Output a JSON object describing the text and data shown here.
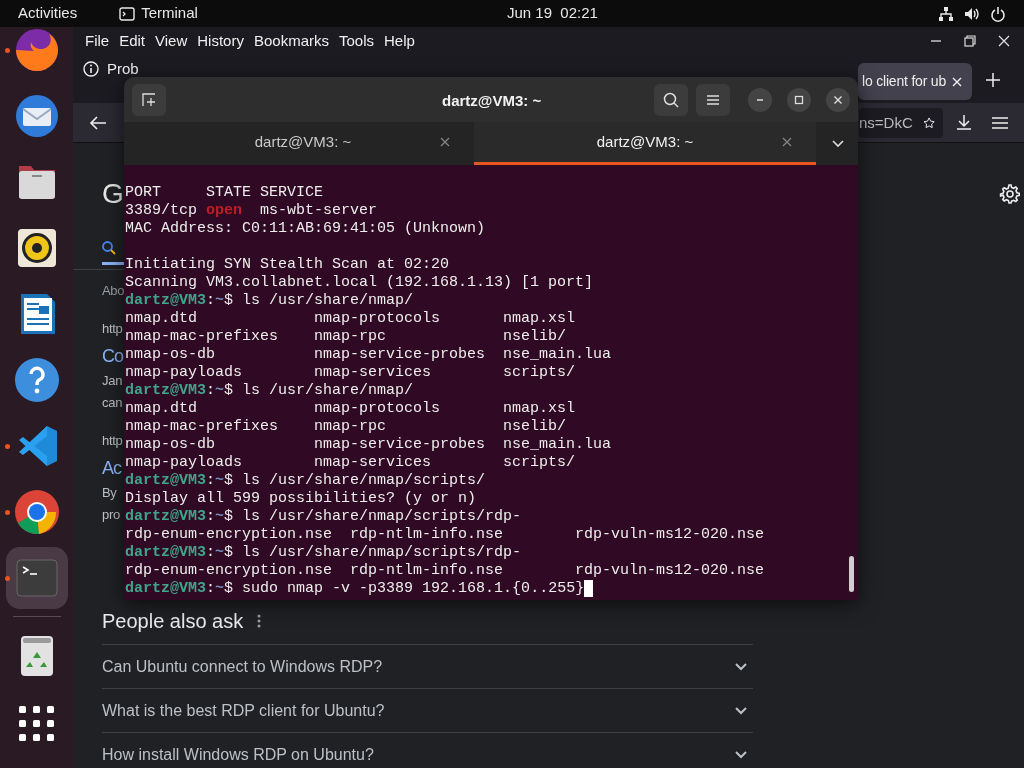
{
  "top_bar": {
    "activities": "Activities",
    "app_name": "Terminal",
    "clock": "Jun 19  02:21"
  },
  "dock": {
    "items": [
      {
        "kind": "globe",
        "running": true,
        "selected": false
      },
      {
        "kind": "mail",
        "running": false,
        "selected": false
      },
      {
        "kind": "folder",
        "running": false,
        "selected": false
      },
      {
        "kind": "speaker",
        "running": false,
        "selected": false
      },
      {
        "kind": "document",
        "running": false,
        "selected": false
      },
      {
        "kind": "help",
        "running": false,
        "selected": false
      },
      {
        "kind": "code",
        "running": true,
        "selected": false
      },
      {
        "kind": "browser",
        "running": true,
        "selected": false
      },
      {
        "kind": "terminal",
        "running": true,
        "selected": true
      }
    ],
    "bottom_items": [
      {
        "kind": "trash"
      },
      {
        "kind": "apps"
      }
    ]
  },
  "browser": {
    "menu": [
      "File",
      "Edit",
      "View",
      "History",
      "Bookmarks",
      "Tools",
      "Help"
    ],
    "tab_fragment": "Prob",
    "tab": {
      "title": "lo client for ub"
    },
    "url_fragment": "ns=DkC",
    "page": {
      "logo_fragment": "G",
      "fragments": [
        {
          "kind": "label",
          "text": "Abo"
        },
        {
          "kind": "url",
          "text": "http"
        },
        {
          "kind": "heading",
          "text": "Co"
        },
        {
          "kind": "snippet",
          "text": "Jan"
        },
        {
          "kind": "snippet",
          "text": "can"
        },
        {
          "kind": "url",
          "text": "http"
        },
        {
          "kind": "heading",
          "text": "Ac"
        },
        {
          "kind": "snippet",
          "text": "By"
        },
        {
          "kind": "snippet",
          "text": "pro"
        }
      ],
      "people_also_ask": {
        "title": "People also ask",
        "questions": [
          "Can Ubuntu connect to Windows RDP?",
          "What is the best RDP client for Ubuntu?",
          "How install Windows RDP on Ubuntu?"
        ]
      }
    }
  },
  "terminal": {
    "title": "dartz@VM3: ~",
    "tabs": [
      {
        "title": "dartz@VM3: ~",
        "selected": false
      },
      {
        "title": "dartz@VM3: ~",
        "selected": true
      }
    ],
    "lines": [
      {
        "kind": "output",
        "text": "PORT     STATE SERVICE"
      },
      {
        "kind": "port",
        "port": "3389/tcp",
        "state": "open",
        "service": "ms-wbt-server"
      },
      {
        "kind": "output",
        "text": "MAC Address: C0:11:AB:69:41:05 (Unknown)"
      },
      {
        "kind": "blank"
      },
      {
        "kind": "output",
        "text": "Initiating SYN Stealth Scan at 02:20"
      },
      {
        "kind": "output",
        "text": "Scanning VM3.collabnet.local (192.168.1.13) [1 port]"
      },
      {
        "kind": "prompt",
        "user": "dartz@VM3",
        "colon": ":",
        "path": "~",
        "symbol": "$",
        "command": "ls /usr/share/nmap/"
      },
      {
        "kind": "output",
        "text": "nmap.dtd             nmap-protocols       nmap.xsl"
      },
      {
        "kind": "output",
        "text": "nmap-mac-prefixes    nmap-rpc             nselib/"
      },
      {
        "kind": "output",
        "text": "nmap-os-db           nmap-service-probes  nse_main.lua"
      },
      {
        "kind": "output",
        "text": "nmap-payloads        nmap-services        scripts/"
      },
      {
        "kind": "prompt",
        "user": "dartz@VM3",
        "colon": ":",
        "path": "~",
        "symbol": "$",
        "command": "ls /usr/share/nmap/"
      },
      {
        "kind": "output",
        "text": "nmap.dtd             nmap-protocols       nmap.xsl"
      },
      {
        "kind": "output",
        "text": "nmap-mac-prefixes    nmap-rpc             nselib/"
      },
      {
        "kind": "output",
        "text": "nmap-os-db           nmap-service-probes  nse_main.lua"
      },
      {
        "kind": "output",
        "text": "nmap-payloads        nmap-services        scripts/"
      },
      {
        "kind": "prompt",
        "user": "dartz@VM3",
        "colon": ":",
        "path": "~",
        "symbol": "$",
        "command": "ls /usr/share/nmap/scripts/"
      },
      {
        "kind": "output",
        "text": "Display all 599 possibilities? (y or n)"
      },
      {
        "kind": "prompt",
        "user": "dartz@VM3",
        "colon": ":",
        "path": "~",
        "symbol": "$",
        "command": "ls /usr/share/nmap/scripts/rdp-"
      },
      {
        "kind": "output",
        "text": "rdp-enum-encryption.nse  rdp-ntlm-info.nse        rdp-vuln-ms12-020.nse"
      },
      {
        "kind": "prompt",
        "user": "dartz@VM3",
        "colon": ":",
        "path": "~",
        "symbol": "$",
        "command": "ls /usr/share/nmap/scripts/rdp-"
      },
      {
        "kind": "output",
        "text": "rdp-enum-encryption.nse  rdp-ntlm-info.nse        rdp-vuln-ms12-020.nse"
      },
      {
        "kind": "prompt",
        "user": "dartz@VM3",
        "colon": ":",
        "path": "~",
        "symbol": "$",
        "command": "sudo nmap -v -p3389 192.168.1.{0..255}",
        "cursor": true
      }
    ]
  }
}
